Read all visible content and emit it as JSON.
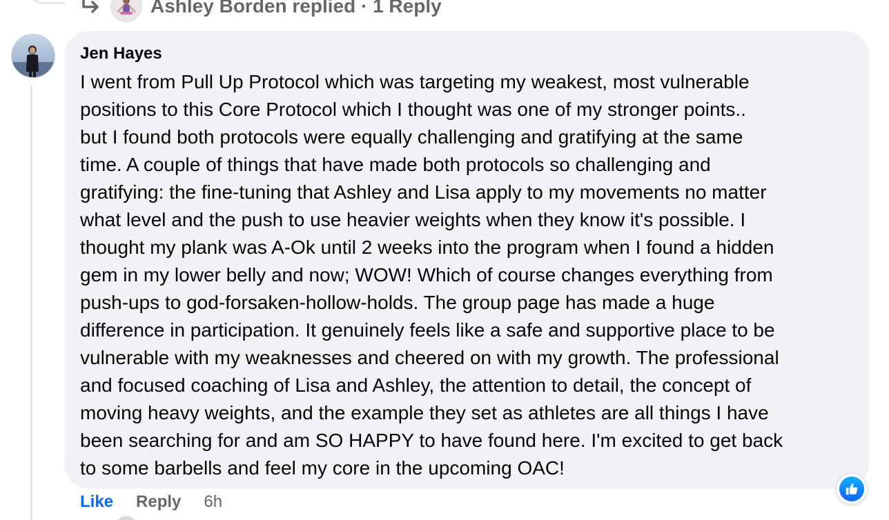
{
  "previous_reply": {
    "text": "Ashley Borden replied · 1 Reply",
    "icon": "reply-arrow-icon"
  },
  "comment": {
    "author": "Jen Hayes",
    "body_lines": [
      "I went from Pull Up Protocol which was targeting my weakest, most vulnerable",
      "positions to this Core Protocol which I thought was one of my stronger points..",
      "but I found both protocols were equally challenging and gratifying at the same",
      "time. A couple of things that have made both protocols so challenging and",
      "gratifying: the fine-tuning that Ashley and Lisa apply to my movements no matter",
      "what level and the push to use heavier weights when they know it's possible. I",
      "thought my plank was A-Ok until 2 weeks into the program when I found a hidden",
      "gem in my lower belly and now; WOW! Which of course changes everything from",
      "push-ups to god-forsaken-hollow-holds. The group page has made a huge",
      "difference in participation. It genuinely feels like a safe and supportive place to be",
      "vulnerable with my weaknesses and cheered on with my growth. The professional",
      "and focused coaching of Lisa and Ashley, the attention to detail, the concept of",
      "moving heavy weights, and the example they set as athletes are all things I have",
      "been searching for and am SO HAPPY to have found here. I'm excited to get back",
      "to some barbells and feel my core in the upcoming OAC!"
    ],
    "reaction_icon": "like-reaction-icon"
  },
  "actions": {
    "like": "Like",
    "reply": "Reply",
    "time": "6h"
  },
  "colors": {
    "bubble": "#f0f2f5",
    "like_blue": "#0866ff",
    "secondary_text": "#65676b",
    "thread_line": "#e4e6eb"
  }
}
